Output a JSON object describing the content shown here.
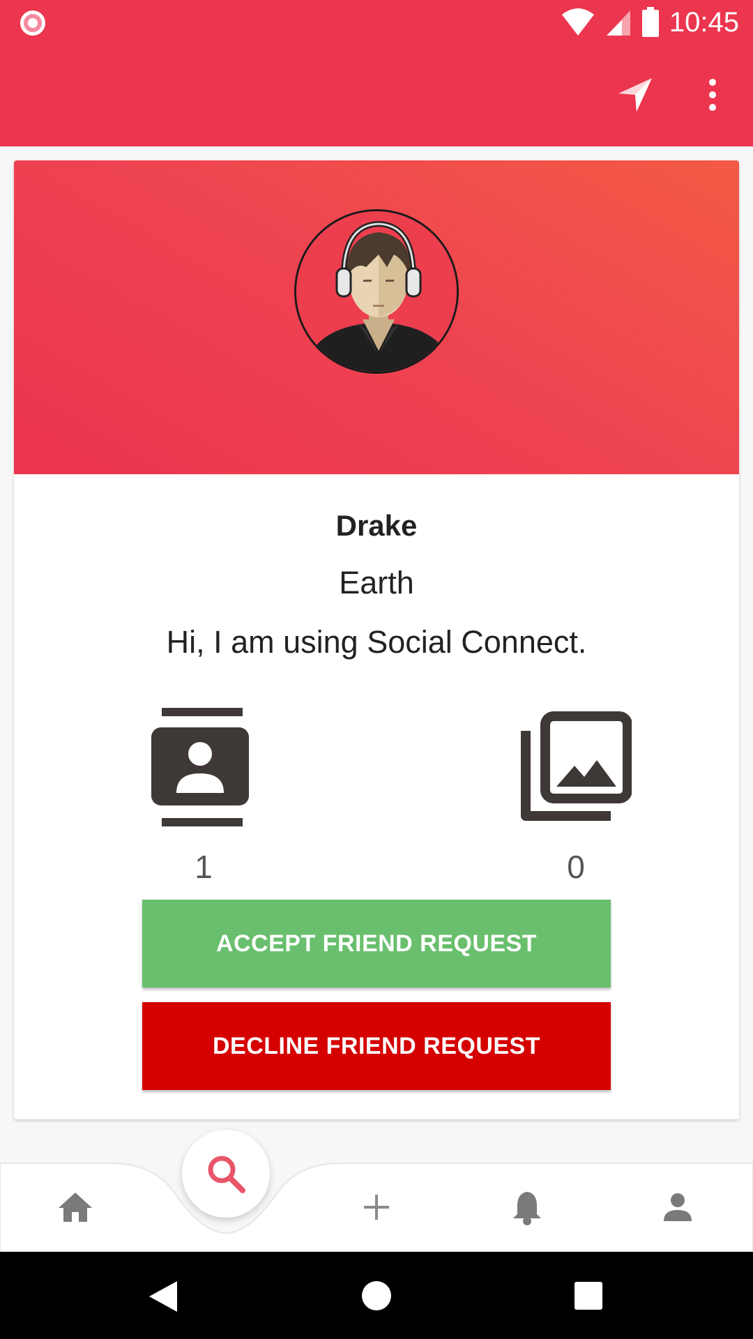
{
  "status_bar": {
    "time": "10:45",
    "icons": [
      "record-icon",
      "wifi-icon",
      "signal-icon",
      "battery-icon"
    ]
  },
  "toolbar": {
    "actions": [
      "send-icon",
      "more-vert-icon"
    ],
    "color": "#ec354e"
  },
  "profile": {
    "name": "Drake",
    "location": "Earth",
    "status": "Hi, I am using Social Connect.",
    "stats": [
      {
        "icon": "contacts-icon",
        "count": "1"
      },
      {
        "icon": "photo-library-icon",
        "count": "0"
      }
    ]
  },
  "actions": {
    "accept_label": "ACCEPT FRIEND REQUEST",
    "decline_label": "DECLINE FRIEND REQUEST",
    "accept_color": "#69bf6d",
    "decline_color": "#d50000"
  },
  "bottom_nav": {
    "items": [
      "home-icon",
      "search-icon",
      "add-icon",
      "notifications-icon",
      "person-icon"
    ],
    "active": "search-icon",
    "accent": "#e8566a"
  },
  "system_nav": [
    "back-icon",
    "home-icon",
    "recents-icon"
  ]
}
